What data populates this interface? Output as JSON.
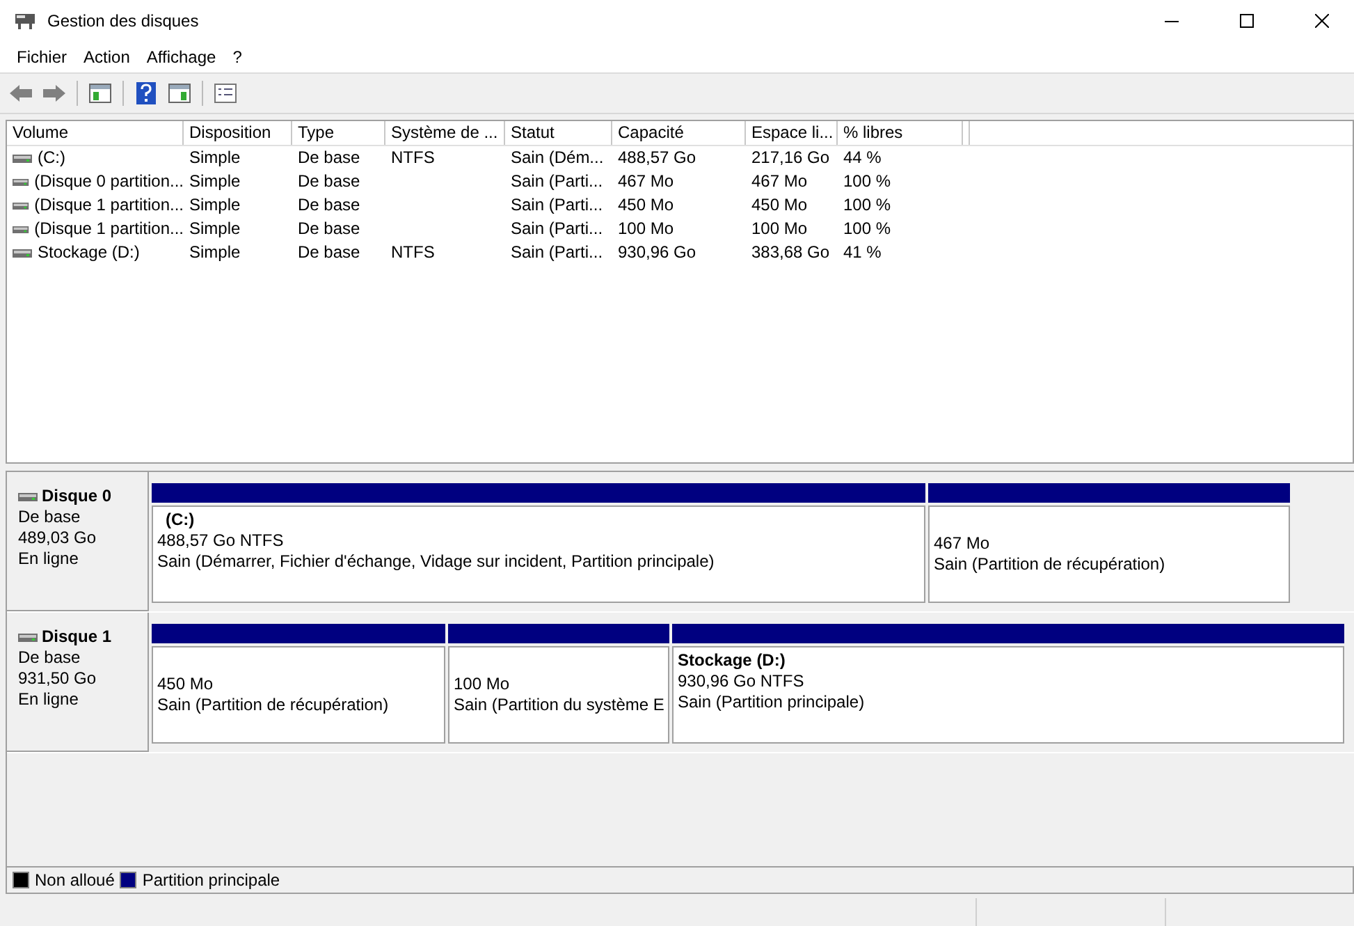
{
  "window": {
    "title": "Gestion des disques"
  },
  "menu": [
    "Fichier",
    "Action",
    "Affichage",
    "?"
  ],
  "table": {
    "columns": [
      "Volume",
      "Disposition",
      "Type",
      "Système de ...",
      "Statut",
      "Capacité",
      "Espace li...",
      "% libres"
    ],
    "rows": [
      {
        "cells": [
          "(C:)",
          "Simple",
          "De base",
          "NTFS",
          "Sain (Dém...",
          "488,57 Go",
          "217,16 Go",
          "44 %"
        ]
      },
      {
        "cells": [
          "(Disque 0 partition...",
          "Simple",
          "De base",
          "",
          "Sain (Parti...",
          "467 Mo",
          "467 Mo",
          "100 %"
        ]
      },
      {
        "cells": [
          "(Disque 1 partition...",
          "Simple",
          "De base",
          "",
          "Sain (Parti...",
          "450 Mo",
          "450 Mo",
          "100 %"
        ]
      },
      {
        "cells": [
          "(Disque 1 partition...",
          "Simple",
          "De base",
          "",
          "Sain (Parti...",
          "100 Mo",
          "100 Mo",
          "100 %"
        ]
      },
      {
        "cells": [
          "Stockage (D:)",
          "Simple",
          "De base",
          "NTFS",
          "Sain (Parti...",
          "930,96 Go",
          "383,68 Go",
          "41 %"
        ]
      }
    ]
  },
  "disks": [
    {
      "name": "Disque 0",
      "type": "De base",
      "size": "489,03 Go",
      "state": "En ligne",
      "partitions": [
        {
          "name": "(C:)",
          "size": "488,57 Go NTFS",
          "status": "Sain (Démarrer, Fichier d'échange, Vidage sur incident, Partition principale)"
        },
        {
          "size": "467 Mo",
          "status": "Sain (Partition de récupération)"
        }
      ]
    },
    {
      "name": "Disque 1",
      "type": "De base",
      "size": "931,50 Go",
      "state": "En ligne",
      "partitions": [
        {
          "size": "450 Mo",
          "status": "Sain (Partition de récupération)"
        },
        {
          "size": "100 Mo",
          "status": "Sain (Partition du système E"
        },
        {
          "name": "Stockage  (D:)",
          "size": "930,96 Go NTFS",
          "status": "Sain (Partition principale)"
        }
      ]
    }
  ],
  "legend": [
    {
      "label": "Non alloué",
      "color": "#000000"
    },
    {
      "label": "Partition principale",
      "color": "#000080"
    }
  ]
}
